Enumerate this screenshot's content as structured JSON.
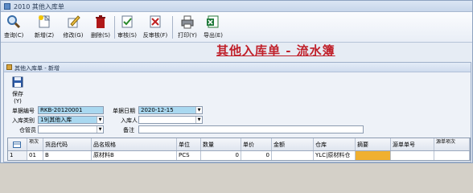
{
  "window": {
    "title": "2010 其他入库单"
  },
  "toolbar": {
    "buttons": [
      {
        "label": "查询(C)",
        "icon": "search-icon",
        "key": "query"
      },
      {
        "label": "新增(Z)",
        "icon": "new-doc-icon",
        "key": "new"
      },
      {
        "label": "修改(G)",
        "icon": "edit-icon",
        "key": "edit"
      },
      {
        "label": "删除(S)",
        "icon": "trash-icon",
        "key": "delete"
      },
      {
        "label": "审核(S)",
        "icon": "approve-icon",
        "key": "approve"
      },
      {
        "label": "反审核(F)",
        "icon": "unapprove-icon",
        "key": "unapprove"
      },
      {
        "label": "打印(Y)",
        "icon": "printer-icon",
        "key": "print"
      },
      {
        "label": "导出(E)",
        "icon": "excel-icon",
        "key": "export"
      }
    ]
  },
  "report_title": "其他入库单 - 流水簿",
  "subwindow": {
    "title": "其他入库单 - 新增",
    "save_label": "保存(Y)"
  },
  "form": {
    "doc_no_label": "单据编号",
    "doc_no_value": "RKB-20120001",
    "doc_date_label": "单据日期",
    "doc_date_value": "2020-12-15",
    "in_type_label": "入库类别",
    "in_type_value": "19|其他入库",
    "in_person_label": "入库人",
    "in_person_value": "",
    "warehouse_mgr_label": "仓管员",
    "warehouse_mgr_value": "",
    "remark_label": "备注",
    "remark_value": ""
  },
  "grid": {
    "headers": {
      "seq": "项次",
      "code": "货品代码",
      "spec": "品名规格",
      "unit": "单位",
      "qty": "数量",
      "price": "单价",
      "amount": "金额",
      "warehouse": "仓库",
      "summary": "摘要",
      "src_doc": "源单单号",
      "src_seq": "源单项次"
    },
    "rows": [
      {
        "no": "1",
        "seq": "01",
        "code": "B",
        "spec": "原材料B",
        "unit": "PCS",
        "qty": "0",
        "price": "0",
        "amount": "",
        "warehouse": "YLC|原材料仓",
        "summary": "",
        "src_doc": "",
        "src_seq": ""
      }
    ]
  },
  "colors": {
    "title_red": "#c0202a",
    "field_blue": "#a9d8f0",
    "summary_orange": "#f0b030"
  }
}
